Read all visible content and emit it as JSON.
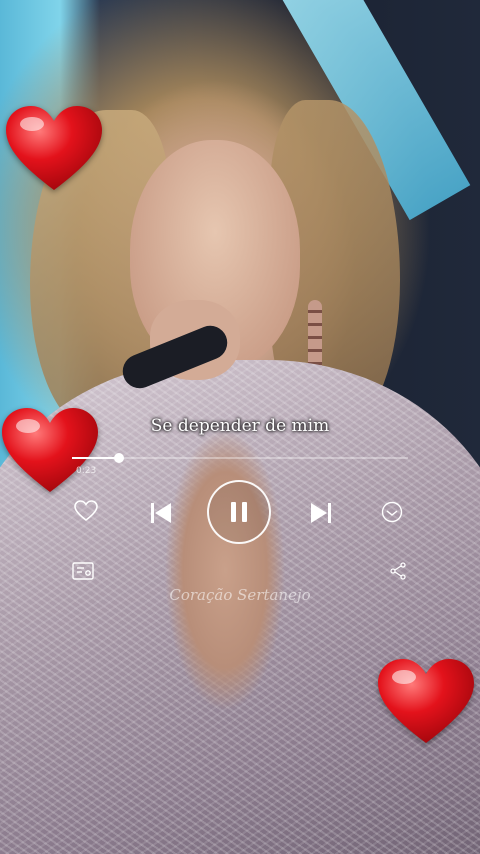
{
  "player": {
    "lyric": "Se depender de mim",
    "elapsed": "0:23",
    "progress_fraction": 0.14,
    "watermark": "Coração Sertanejo"
  },
  "icons": {
    "like": "heart-outline-icon",
    "previous": "skip-previous-icon",
    "play_pause": "pause-icon",
    "next": "skip-next-icon",
    "more": "more-icon",
    "lyrics": "lyrics-icon",
    "share": "share-icon",
    "overlay_hearts": "red-heart-icon"
  },
  "colors": {
    "heart": "#e3121b",
    "controls": "#ffffff"
  }
}
